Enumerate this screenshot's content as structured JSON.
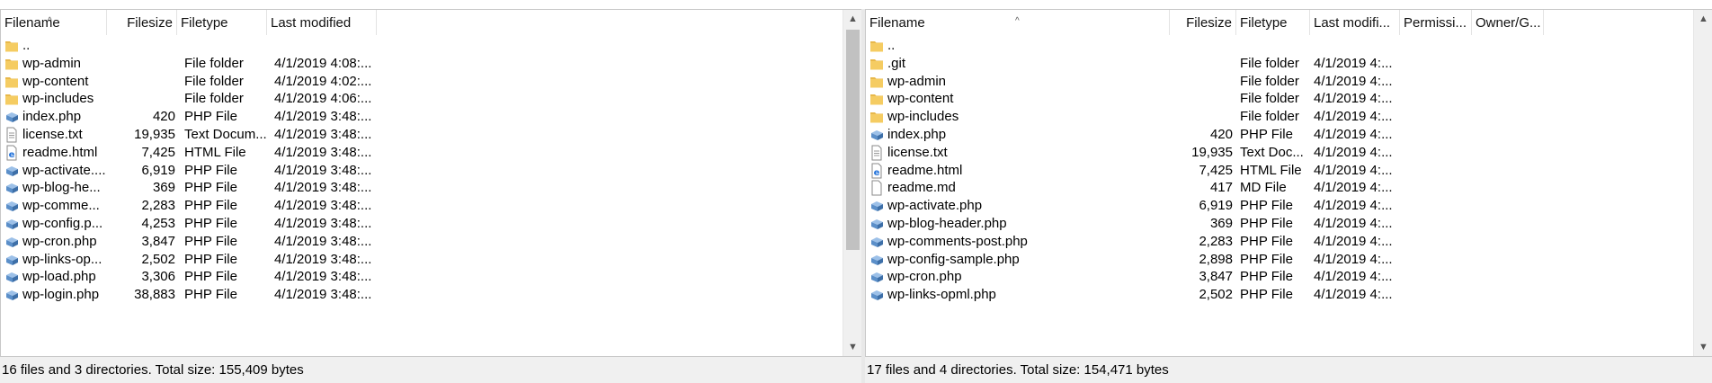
{
  "colors": {
    "folder": "#e8b84a",
    "php_icon": "#5b8fc9",
    "html_icon": "#1e6fd9",
    "text_icon": "#8a8a8a",
    "status_bg": "#f0f0f0"
  },
  "local": {
    "columns": {
      "filename": "Filename",
      "filesize": "Filesize",
      "filetype": "Filetype",
      "last_modified": "Last modified"
    },
    "rows": [
      {
        "name": "..",
        "size": "",
        "type": "",
        "modified": "",
        "icon": "folder-icon"
      },
      {
        "name": "wp-admin",
        "size": "",
        "type": "File folder",
        "modified": "4/1/2019 4:08:...",
        "icon": "folder-icon"
      },
      {
        "name": "wp-content",
        "size": "",
        "type": "File folder",
        "modified": "4/1/2019 4:02:...",
        "icon": "folder-icon"
      },
      {
        "name": "wp-includes",
        "size": "",
        "type": "File folder",
        "modified": "4/1/2019 4:06:...",
        "icon": "folder-icon"
      },
      {
        "name": "index.php",
        "size": "420",
        "type": "PHP File",
        "modified": "4/1/2019 3:48:...",
        "icon": "php-file-icon"
      },
      {
        "name": "license.txt",
        "size": "19,935",
        "type": "Text Docum...",
        "modified": "4/1/2019 3:48:...",
        "icon": "text-file-icon"
      },
      {
        "name": "readme.html",
        "size": "7,425",
        "type": "HTML File",
        "modified": "4/1/2019 3:48:...",
        "icon": "html-file-icon"
      },
      {
        "name": "wp-activate....",
        "size": "6,919",
        "type": "PHP File",
        "modified": "4/1/2019 3:48:...",
        "icon": "php-file-icon"
      },
      {
        "name": "wp-blog-he...",
        "size": "369",
        "type": "PHP File",
        "modified": "4/1/2019 3:48:...",
        "icon": "php-file-icon"
      },
      {
        "name": "wp-comme...",
        "size": "2,283",
        "type": "PHP File",
        "modified": "4/1/2019 3:48:...",
        "icon": "php-file-icon"
      },
      {
        "name": "wp-config.p...",
        "size": "4,253",
        "type": "PHP File",
        "modified": "4/1/2019 3:48:...",
        "icon": "php-file-icon"
      },
      {
        "name": "wp-cron.php",
        "size": "3,847",
        "type": "PHP File",
        "modified": "4/1/2019 3:48:...",
        "icon": "php-file-icon"
      },
      {
        "name": "wp-links-op...",
        "size": "2,502",
        "type": "PHP File",
        "modified": "4/1/2019 3:48:...",
        "icon": "php-file-icon"
      },
      {
        "name": "wp-load.php",
        "size": "3,306",
        "type": "PHP File",
        "modified": "4/1/2019 3:48:...",
        "icon": "php-file-icon"
      },
      {
        "name": "wp-login.php",
        "size": "38,883",
        "type": "PHP File",
        "modified": "4/1/2019 3:48:...",
        "icon": "php-file-icon"
      }
    ],
    "status": "16 files and 3 directories. Total size: 155,409 bytes"
  },
  "remote": {
    "columns": {
      "filename": "Filename",
      "filesize": "Filesize",
      "filetype": "Filetype",
      "last_modified": "Last modifi...",
      "permissions": "Permissi...",
      "owner": "Owner/G..."
    },
    "rows": [
      {
        "name": "..",
        "size": "",
        "type": "",
        "modified": "",
        "icon": "folder-icon"
      },
      {
        "name": ".git",
        "size": "",
        "type": "File folder",
        "modified": "4/1/2019 4:...",
        "icon": "folder-icon"
      },
      {
        "name": "wp-admin",
        "size": "",
        "type": "File folder",
        "modified": "4/1/2019 4:...",
        "icon": "folder-icon"
      },
      {
        "name": "wp-content",
        "size": "",
        "type": "File folder",
        "modified": "4/1/2019 4:...",
        "icon": "folder-icon"
      },
      {
        "name": "wp-includes",
        "size": "",
        "type": "File folder",
        "modified": "4/1/2019 4:...",
        "icon": "folder-icon"
      },
      {
        "name": "index.php",
        "size": "420",
        "type": "PHP File",
        "modified": "4/1/2019 4:...",
        "icon": "php-file-icon"
      },
      {
        "name": "license.txt",
        "size": "19,935",
        "type": "Text Doc...",
        "modified": "4/1/2019 4:...",
        "icon": "text-file-icon"
      },
      {
        "name": "readme.html",
        "size": "7,425",
        "type": "HTML File",
        "modified": "4/1/2019 4:...",
        "icon": "html-file-icon"
      },
      {
        "name": "readme.md",
        "size": "417",
        "type": "MD File",
        "modified": "4/1/2019 4:...",
        "icon": "md-file-icon"
      },
      {
        "name": "wp-activate.php",
        "size": "6,919",
        "type": "PHP File",
        "modified": "4/1/2019 4:...",
        "icon": "php-file-icon"
      },
      {
        "name": "wp-blog-header.php",
        "size": "369",
        "type": "PHP File",
        "modified": "4/1/2019 4:...",
        "icon": "php-file-icon"
      },
      {
        "name": "wp-comments-post.php",
        "size": "2,283",
        "type": "PHP File",
        "modified": "4/1/2019 4:...",
        "icon": "php-file-icon"
      },
      {
        "name": "wp-config-sample.php",
        "size": "2,898",
        "type": "PHP File",
        "modified": "4/1/2019 4:...",
        "icon": "php-file-icon"
      },
      {
        "name": "wp-cron.php",
        "size": "3,847",
        "type": "PHP File",
        "modified": "4/1/2019 4:...",
        "icon": "php-file-icon"
      },
      {
        "name": "wp-links-opml.php",
        "size": "2,502",
        "type": "PHP File",
        "modified": "4/1/2019 4:...",
        "icon": "php-file-icon"
      }
    ],
    "status": "17 files and 4 directories. Total size: 154,471 bytes"
  }
}
